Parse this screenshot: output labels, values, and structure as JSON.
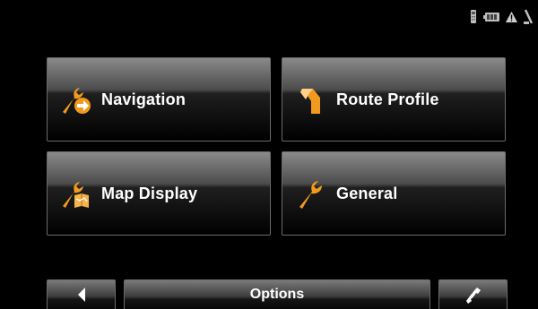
{
  "status_bar": {
    "icons": [
      "gps-receiver-icon",
      "battery-icon",
      "warning-icon",
      "satellite-icon"
    ]
  },
  "tiles": [
    {
      "label": "Navigation",
      "icon": "wrench-navigation-icon"
    },
    {
      "label": "Route Profile",
      "icon": "route-profile-icon"
    },
    {
      "label": "Map Display",
      "icon": "wrench-map-icon"
    },
    {
      "label": "General",
      "icon": "wrench-icon"
    }
  ],
  "bottom_bar": {
    "title": "Options",
    "back_icon": "back-arrow-icon",
    "right_icon": "phone-icon"
  },
  "colors": {
    "accent": "#f29a1d",
    "background": "#000000",
    "text": "#ffffff"
  }
}
